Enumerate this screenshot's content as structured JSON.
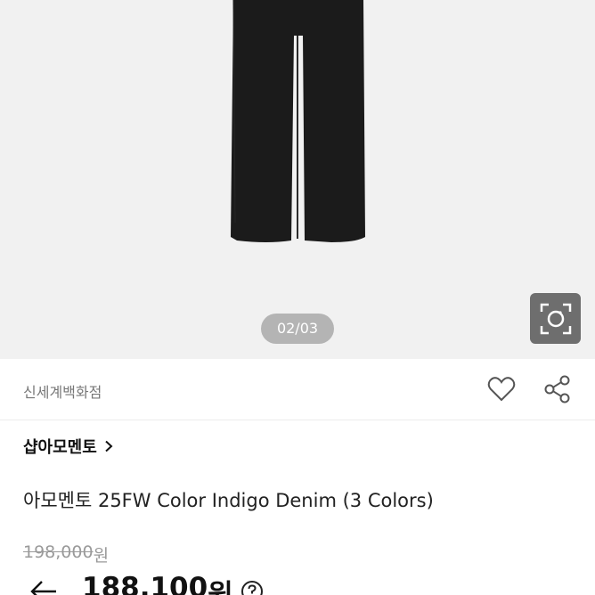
{
  "gallery": {
    "pager": "02/03"
  },
  "store": {
    "name": "신세계백화점"
  },
  "brand": {
    "name": "샵아모멘토"
  },
  "product": {
    "title": "아모멘토 25FW Color Indigo Denim (3 Colors)"
  },
  "price": {
    "original": "198,000",
    "original_unit": "원",
    "sale": "188,100",
    "sale_unit": "원"
  },
  "icons": {
    "lens": "image-search-icon",
    "like": "heart-icon",
    "share": "share-icon",
    "brand_link": "chevron-right-icon",
    "back": "arrow-left-icon",
    "help": "question-circle-icon"
  },
  "colors": {
    "gallery_bg": "#f1f1f1",
    "pager_bg": "#b4b4b4",
    "lens_bg": "#6e6e6e",
    "pants": "#1b1b1b"
  }
}
